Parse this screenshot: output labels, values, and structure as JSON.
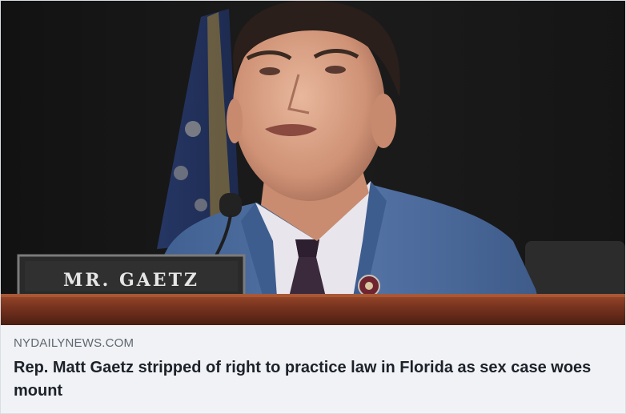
{
  "link_preview": {
    "image": {
      "alt": "",
      "nameplate_text": "MR. GAETZ"
    },
    "domain": "NYDAILYNEWS.COM",
    "headline": "Rep. Matt Gaetz stripped of right to practice law in Florida as sex case woes mount"
  },
  "colors": {
    "caption_background": "#f0f2f5",
    "domain_text": "#606770",
    "headline_text": "#1d2129",
    "suit_blue": "#4a6a9a",
    "desk_wood": "#7a3a22"
  }
}
